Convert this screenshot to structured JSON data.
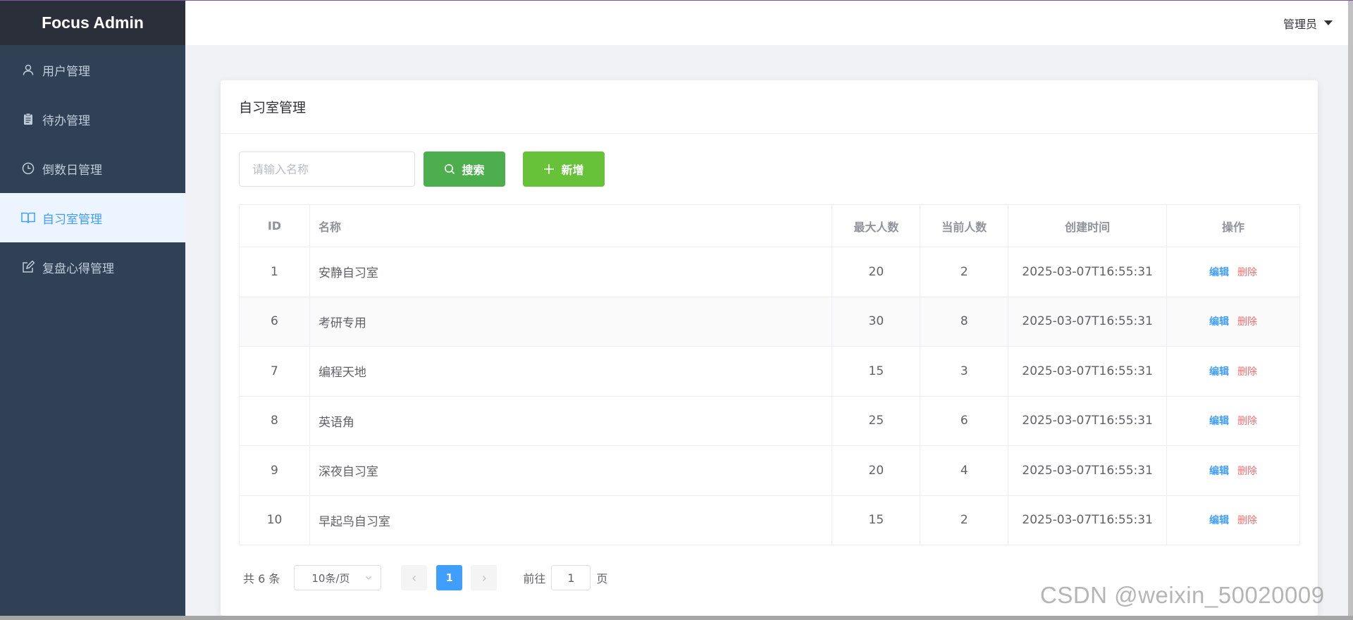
{
  "app": {
    "title": "Focus Admin"
  },
  "sidebar": {
    "items": [
      {
        "label": "用户管理",
        "icon": "user-icon",
        "active": false
      },
      {
        "label": "待办管理",
        "icon": "clipboard-icon",
        "active": false
      },
      {
        "label": "倒数日管理",
        "icon": "clock-icon",
        "active": false
      },
      {
        "label": "自习室管理",
        "icon": "book-icon",
        "active": true
      },
      {
        "label": "复盘心得管理",
        "icon": "edit-icon",
        "active": false
      }
    ]
  },
  "header": {
    "user_label": "管理员"
  },
  "card": {
    "title": "自习室管理"
  },
  "toolbar": {
    "search_placeholder": "请输入名称",
    "search_value": "",
    "search_label": "搜索",
    "add_label": "新增"
  },
  "table": {
    "columns": [
      "ID",
      "名称",
      "最大人数",
      "当前人数",
      "创建时间",
      "操作"
    ],
    "rows": [
      {
        "id": "1",
        "name": "安静自习室",
        "max": "20",
        "current": "2",
        "created": "2025-03-07T16:55:31"
      },
      {
        "id": "6",
        "name": "考研专用",
        "max": "30",
        "current": "8",
        "created": "2025-03-07T16:55:31"
      },
      {
        "id": "7",
        "name": "编程天地",
        "max": "15",
        "current": "3",
        "created": "2025-03-07T16:55:31"
      },
      {
        "id": "8",
        "name": "英语角",
        "max": "25",
        "current": "6",
        "created": "2025-03-07T16:55:31"
      },
      {
        "id": "9",
        "name": "深夜自习室",
        "max": "20",
        "current": "4",
        "created": "2025-03-07T16:55:31"
      },
      {
        "id": "10",
        "name": "早起鸟自习室",
        "max": "15",
        "current": "2",
        "created": "2025-03-07T16:55:31"
      }
    ],
    "edit_label": "编辑",
    "delete_label": "删除"
  },
  "pagination": {
    "total_label": "共 6 条",
    "page_size": "10条/页",
    "current_page": "1",
    "goto_label": "前往",
    "goto_value": "1",
    "page_suffix": "页"
  },
  "watermark": "CSDN @weixin_50020009",
  "colors": {
    "sidebar_bg": "#304156",
    "logo_bg": "#2b2f3a",
    "active_bg": "#ecf5ff",
    "primary": "#409eff",
    "search_btn": "#4cae4c",
    "add_btn": "#67c23a",
    "danger": "#f56c6c"
  }
}
